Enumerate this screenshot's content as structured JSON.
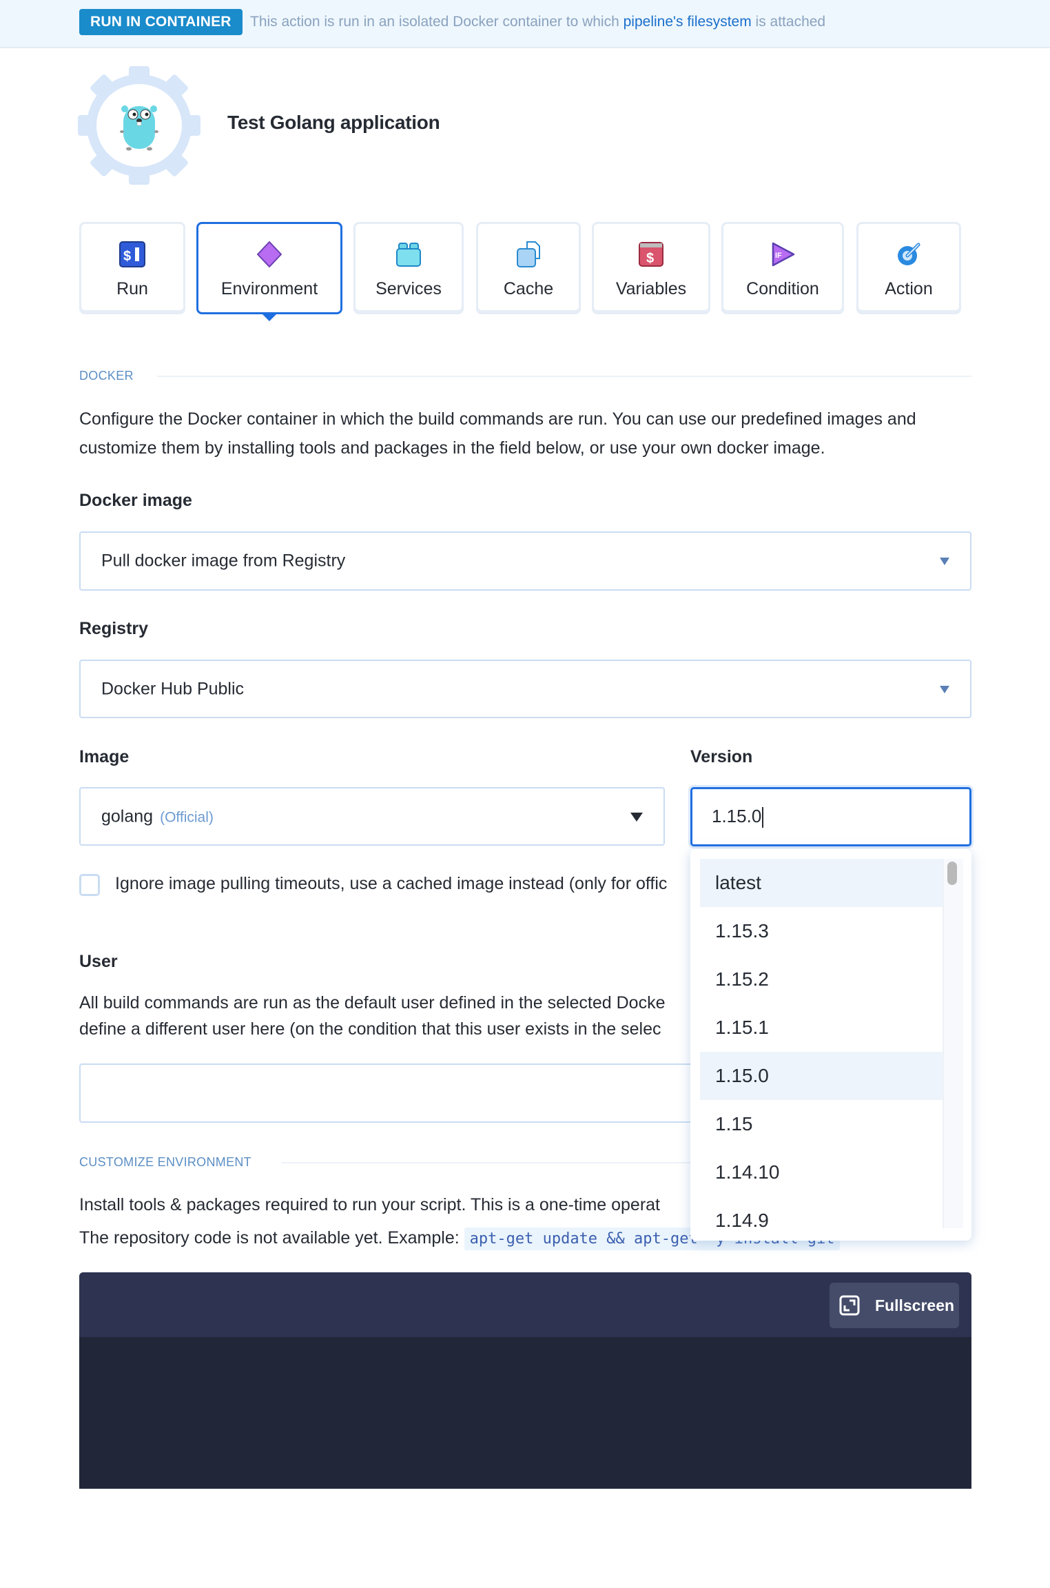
{
  "banner": {
    "badge": "RUN IN CONTAINER",
    "text_before": "This action is run in an isolated Docker container to which ",
    "link": "pipeline's filesystem",
    "text_after": " is attached"
  },
  "header": {
    "logo_icon": "golang-gopher-gear-icon",
    "title": "Test Golang application"
  },
  "tabs": [
    {
      "label": "Run",
      "icon": "terminal-dollar-icon",
      "active": false
    },
    {
      "label": "Environment",
      "icon": "diamond-icon",
      "active": true
    },
    {
      "label": "Services",
      "icon": "brick-icon",
      "active": false
    },
    {
      "label": "Cache",
      "icon": "cache-files-icon",
      "active": false
    },
    {
      "label": "Variables",
      "icon": "dollar-wallet-icon",
      "active": false
    },
    {
      "label": "Condition",
      "icon": "if-play-icon",
      "active": false
    },
    {
      "label": "Action",
      "icon": "gear-wrench-icon",
      "active": false
    }
  ],
  "docker": {
    "section_label": "DOCKER",
    "description_line1": "Configure the Docker container in which the build commands are run. You can use our predefined images and",
    "description_line2": "customize them by installing tools and packages in the field below, or use your own docker image.",
    "docker_image": {
      "label": "Docker image",
      "value": "Pull docker image from Registry"
    },
    "registry": {
      "label": "Registry",
      "value": "Docker Hub Public"
    },
    "image": {
      "label": "Image",
      "value": "golang",
      "tag": "(Official)"
    },
    "version": {
      "label": "Version",
      "value": "1.15.0",
      "options": [
        "latest",
        "1.15.3",
        "1.15.2",
        "1.15.1",
        "1.15.0",
        "1.15",
        "1.14.10",
        "1.14.9"
      ],
      "highlighted": [
        "latest",
        "1.15.0"
      ]
    },
    "ignore_timeouts_label": "Ignore image pulling timeouts, use a cached image instead (only for offic",
    "ignore_timeouts_checked": false
  },
  "user": {
    "label": "User",
    "description_line1": "All build commands are run as the default user defined in the selected Docke",
    "description_line2": "define a different user here (on the condition that this user exists in the selec",
    "value": ""
  },
  "customize": {
    "section_label": "CUSTOMIZE ENVIRONMENT",
    "description_line1": "Install tools & packages required to run your script. This is a one-time operat",
    "description_line2_prefix": "The repository code is not available yet. Example: ",
    "example_code": "apt-get update && apt-get -y install git"
  },
  "editor": {
    "fullscreen_label": "Fullscreen",
    "content": ""
  },
  "colors": {
    "accent": "#1f6fe0",
    "badge": "#1a8bcb",
    "banner_bg": "#eef7fd",
    "editor_bg": "#212638",
    "editor_header": "#2d3350"
  }
}
